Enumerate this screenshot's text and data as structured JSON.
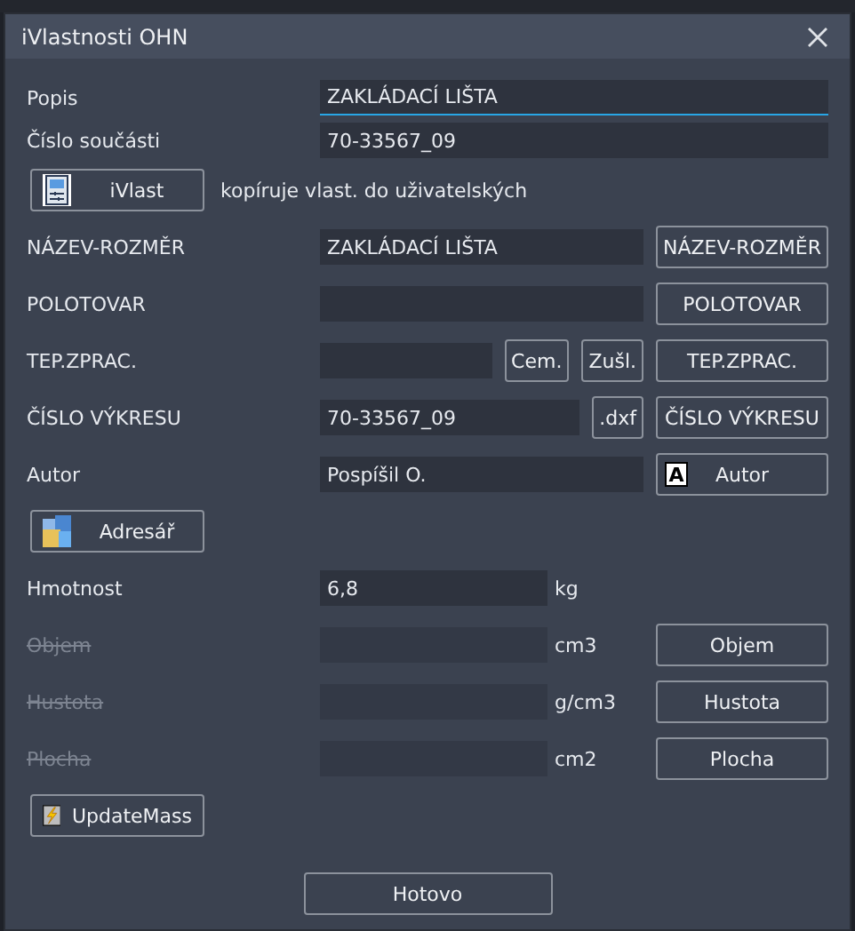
{
  "window": {
    "title": "iVlastnosti OHN"
  },
  "top_fields": [
    {
      "label": "Popis",
      "value": "ZAKLÁDACÍ LIŠTA",
      "focused": true
    },
    {
      "label": "Číslo součásti",
      "value": "70-33567_09",
      "focused": false
    }
  ],
  "ivlast": {
    "button": "iVlast",
    "note": "kopíruje vlast. do uživatelských"
  },
  "property_rows": [
    {
      "label": "NÁZEV-ROZMĚR",
      "value": "ZAKLÁDACÍ LIŠTA",
      "button": "NÁZEV-ROZMĚR"
    },
    {
      "label": "POLOTOVAR",
      "button": "POLOTOVAR"
    },
    {
      "label": "TEP.ZPRAC.",
      "extra_buttons": [
        "Cem.",
        "Zušl."
      ],
      "button": "TEP.ZPRAC."
    },
    {
      "label": "ČÍSLO VÝKRESU",
      "value": "70-33567_09",
      "extra_buttons": [
        ".dxf"
      ],
      "button": "ČÍSLO VÝKRESU"
    },
    {
      "label": "Autor",
      "value": "Pospíšil O.",
      "button": "Autor",
      "button_badge": "A"
    }
  ],
  "folder_button": "Adresář",
  "mass_rows": [
    {
      "label": "Hmotnost",
      "value": "6,8",
      "unit": "kg",
      "disabled": false
    },
    {
      "label": "Objem",
      "unit": "cm3",
      "disabled": true,
      "button": "Objem"
    },
    {
      "label": "Hustota",
      "unit": "g/cm3",
      "disabled": true,
      "button": "Hustota"
    },
    {
      "label": "Plocha",
      "unit": "cm2",
      "disabled": true,
      "button": "Plocha"
    }
  ],
  "update_button": "UpdateMass",
  "ok_button": "Hotovo"
}
